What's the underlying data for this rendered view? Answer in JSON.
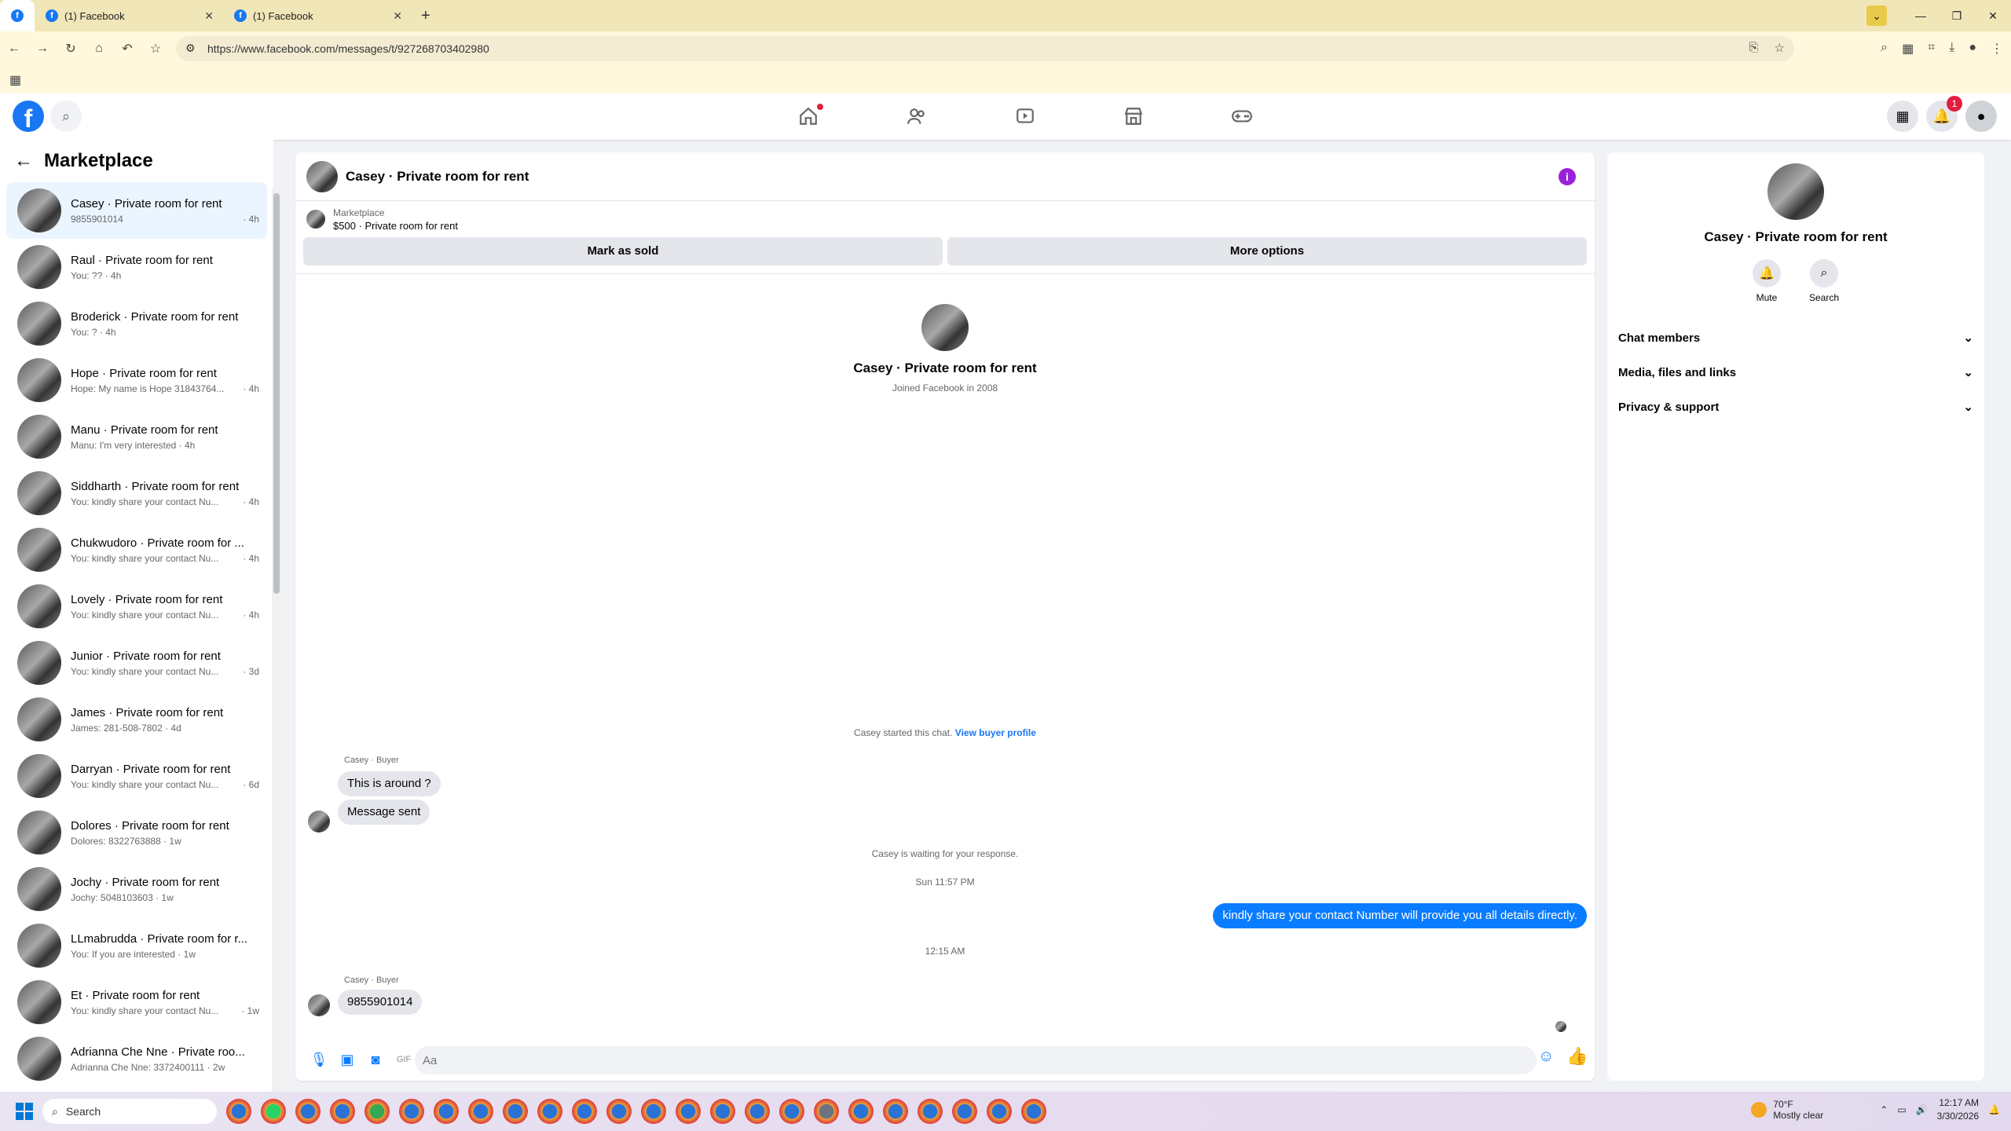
{
  "browser": {
    "tabs": [
      {
        "label": ""
      },
      {
        "label": "(1) Facebook"
      },
      {
        "label": "(1) Facebook"
      }
    ],
    "url": "https://www.facebook.com/messages/t/927268703402980"
  },
  "fb": {
    "notif_count": "1"
  },
  "sidebar": {
    "title": "Marketplace",
    "conversations": [
      {
        "name": "Casey · Private room for rent",
        "snippet": "9855901014",
        "time": "· 4h"
      },
      {
        "name": "Raul · Private room for rent",
        "snippet": "You: ?? · 4h",
        "time": ""
      },
      {
        "name": "Broderick · Private room for rent",
        "snippet": "You: ? · 4h",
        "time": ""
      },
      {
        "name": "Hope · Private room for rent",
        "snippet": "Hope: My name is Hope 31843764...",
        "time": "· 4h"
      },
      {
        "name": "Manu · Private room for rent",
        "snippet": "Manu: I'm very interested · 4h",
        "time": ""
      },
      {
        "name": "Siddharth · Private room for rent",
        "snippet": "You: kindly share your contact Nu...",
        "time": "· 4h"
      },
      {
        "name": "Chukwudoro · Private room for ...",
        "snippet": "You: kindly share your contact Nu...",
        "time": "· 4h"
      },
      {
        "name": "Lovely · Private room for rent",
        "snippet": "You: kindly share your contact Nu...",
        "time": "· 4h"
      },
      {
        "name": "Junior · Private room for rent",
        "snippet": "You: kindly share your contact Nu...",
        "time": "· 3d"
      },
      {
        "name": "James · Private room for rent",
        "snippet": "James: 281-508-7802 · 4d",
        "time": ""
      },
      {
        "name": "Darryan · Private room for rent",
        "snippet": "You: kindly share your contact Nu...",
        "time": "· 6d"
      },
      {
        "name": "Dolores · Private room for rent",
        "snippet": "Dolores: 8322763888 · 1w",
        "time": ""
      },
      {
        "name": "Jochy · Private room for rent",
        "snippet": "Jochy: 5048103603 · 1w",
        "time": ""
      },
      {
        "name": "LLmabrudda · Private room for r...",
        "snippet": "You: If you are interested · 1w",
        "time": ""
      },
      {
        "name": "Et · Private room for rent",
        "snippet": "You: kindly share your contact Nu...",
        "time": "· 1w"
      },
      {
        "name": "Adrianna Che Nne · Private roo...",
        "snippet": "Adrianna Che Nne: 3372400111 · 2w",
        "time": ""
      }
    ]
  },
  "chat": {
    "title": "Casey · Private room for rent",
    "listing_source": "Marketplace",
    "listing_price": "$500 · Private room for rent",
    "mark_sold": "Mark as sold",
    "more_options": "More options",
    "profile_name": "Casey · Private room for rent",
    "joined": "Joined Facebook in 2008",
    "started_text": "Casey started this chat.",
    "view_profile": "View buyer profile",
    "sender1": "Casey · Buyer",
    "msg1": "This is around ?",
    "msg2": "Message sent",
    "waiting": "Casey is waiting for your response.",
    "time1": "Sun 11:57 PM",
    "outgoing": "kindly share your contact Number will provide you all details directly.",
    "time2": "12:15 AM",
    "sender2": "Casey · Buyer",
    "msg3": "9855901014",
    "composer_placeholder": "Aa"
  },
  "rpanel": {
    "name": "Casey · Private room for rent",
    "mute": "Mute",
    "search": "Search",
    "sections": [
      "Chat members",
      "Media, files and links",
      "Privacy & support"
    ]
  },
  "taskbar": {
    "search": "Search",
    "temp": "70°F",
    "weather": "Mostly clear",
    "time": "12:17 AM",
    "date": "3/30/2026"
  }
}
